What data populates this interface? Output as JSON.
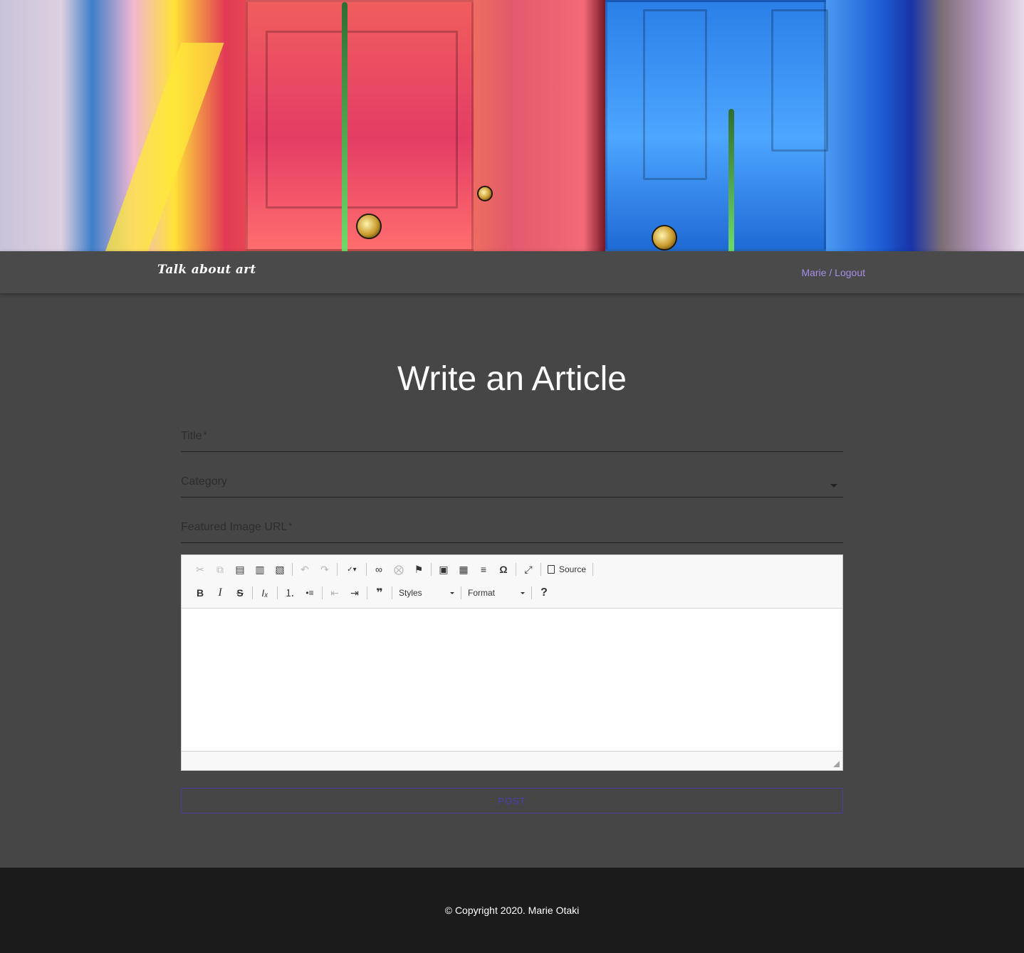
{
  "navbar": {
    "brand": "Talk about art",
    "user_link": "Marie",
    "separator": " / ",
    "logout_link": "Logout",
    "link_color": "#a58ee8"
  },
  "hero": {
    "image_name": "colorful-painted-doors-image"
  },
  "main": {
    "title": "Write an Article",
    "fields": {
      "title": {
        "label": "Title",
        "required_mark": "*"
      },
      "category": {
        "label": "Category"
      },
      "featured_image": {
        "label": "Featured Image URL",
        "required_mark": "*"
      }
    },
    "editor": {
      "row1": [
        "cut-icon",
        "copy-icon",
        "paste-icon",
        "paste-text-icon",
        "paste-word-icon",
        "undo-icon",
        "redo-icon",
        "spellcheck-icon",
        "link-icon",
        "unlink-icon",
        "anchor-icon",
        "image-icon",
        "table-icon",
        "horizontal-line-icon",
        "special-char-icon",
        "maximize-icon",
        "source-icon"
      ],
      "row2": [
        "bold-icon",
        "italic-icon",
        "strike-icon",
        "remove-format-icon",
        "numbered-list-icon",
        "bulleted-list-icon",
        "outdent-icon",
        "indent-icon",
        "blockquote-icon",
        "help-icon"
      ],
      "source_label": "Source",
      "styles_label": "Styles",
      "format_label": "Format",
      "glyphs": {
        "cut": "✂",
        "copy": "⧉",
        "paste": "📋",
        "undo": "↶",
        "redo": "↷",
        "spell": "ᴬᴮᶜ",
        "link": "∞",
        "anchor": "⚑",
        "image": "▣",
        "table": "▦",
        "hr": "≡",
        "omega": "Ω",
        "maximize": "⤢",
        "bold": "B",
        "italic": "I",
        "strike": "S",
        "removefmt": "Iₓ",
        "olist": "⒈",
        "ulist": "•≡",
        "outdent": "⇤",
        "indent": "⇥",
        "quote": "❞",
        "help": "?"
      }
    },
    "post_button": "POST",
    "accent_color": "#4a3fb3"
  },
  "footer": {
    "copyright": "© Copyright 2020. Marie Otaki"
  }
}
